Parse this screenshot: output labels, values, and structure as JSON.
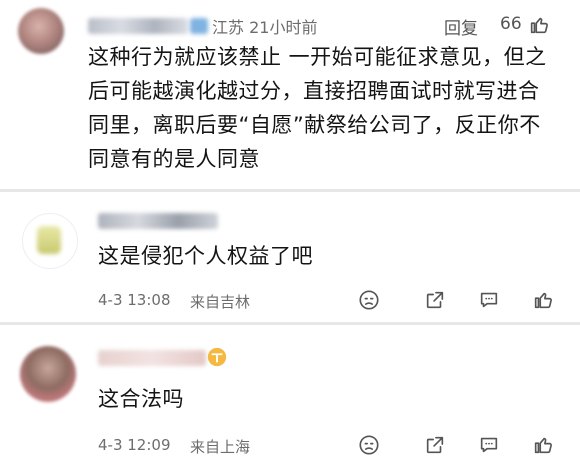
{
  "comments": [
    {
      "location_time": "江苏  21小时前",
      "reply_label": "回复",
      "like_count": "66",
      "text_lines": [
        "这种行为就应该禁止 一开始可能征求意见，但之",
        "后可能越演化越过分，直接招聘面试时就写进合",
        "同里，离职后要“自愿”献祭给公司了，反正你不",
        "同意有的是人同意"
      ]
    },
    {
      "text": "这是侵犯个人权益了吧",
      "date": "4-3 13:08",
      "location": "来自吉林"
    },
    {
      "text": "这合法吗",
      "date": "4-3 12:09",
      "location": "来自上海"
    }
  ],
  "icons": {
    "accent": "#5b6cf5",
    "action_icons": [
      "emoji-dislike-icon",
      "share-icon",
      "comment-icon",
      "like-icon"
    ]
  }
}
